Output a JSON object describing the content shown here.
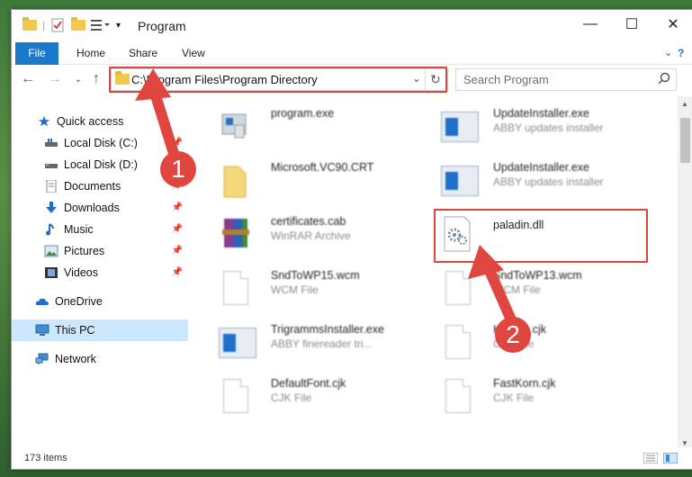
{
  "window": {
    "title": "Program"
  },
  "ribbon": {
    "tabs": [
      "File",
      "Home",
      "Share",
      "View"
    ]
  },
  "address": {
    "path": "C:\\Program Files\\Program Directory"
  },
  "search": {
    "placeholder": "Search Program"
  },
  "sidebar": {
    "items": [
      {
        "label": "Quick access",
        "icon": "star-icon",
        "pinned": false
      },
      {
        "label": "Local Disk (C:)",
        "icon": "drive-icon",
        "pinned": true
      },
      {
        "label": "Local Disk (D:)",
        "icon": "drive-icon",
        "pinned": false
      },
      {
        "label": "Documents",
        "icon": "documents-icon",
        "pinned": true
      },
      {
        "label": "Downloads",
        "icon": "download-icon",
        "pinned": true
      },
      {
        "label": "Music",
        "icon": "music-icon",
        "pinned": true
      },
      {
        "label": "Pictures",
        "icon": "pictures-icon",
        "pinned": true
      },
      {
        "label": "Videos",
        "icon": "videos-icon",
        "pinned": true
      },
      {
        "label": "OneDrive",
        "icon": "cloud-icon",
        "pinned": false
      },
      {
        "label": "This PC",
        "icon": "computer-icon",
        "pinned": false,
        "selected": true
      },
      {
        "label": "Network",
        "icon": "network-icon",
        "pinned": false
      }
    ]
  },
  "files": [
    {
      "name": "program.exe",
      "type": "",
      "icon": "exe-icon"
    },
    {
      "name": "UpdateInstaller.exe",
      "type": "ABBY updates installer",
      "icon": "installer-icon"
    },
    {
      "name": "Microsoft.VC90.CRT",
      "type": "",
      "icon": "folder-icon"
    },
    {
      "name": "UpdateInstaller.exe",
      "type": "ABBY updates installer",
      "icon": "installer-icon"
    },
    {
      "name": "certificates.cab",
      "type": "WinRAR Archive",
      "icon": "archive-icon"
    },
    {
      "name": "paladin.dll",
      "type": "",
      "icon": "dll-gear-icon"
    },
    {
      "name": "SndToWP15.wcm",
      "type": "WCM File",
      "icon": "file-icon"
    },
    {
      "name": "SndToWP13.wcm",
      "type": "WCM File",
      "icon": "file-icon"
    },
    {
      "name": "TrigrammsInstaller.exe",
      "type": "ABBY finereader tri...",
      "icon": "installer-icon"
    },
    {
      "name": "Korean.cjk",
      "type": "CJK File",
      "icon": "file-icon"
    },
    {
      "name": "DefaultFont.cjk",
      "type": "CJK File",
      "icon": "file-icon"
    },
    {
      "name": "FastKorn.cjk",
      "type": "CJK File",
      "icon": "file-icon"
    }
  ],
  "status": {
    "items_count": "173 items"
  },
  "annotations": {
    "step1": "1",
    "step2": "2"
  },
  "colors": {
    "accent": "#1979ca",
    "highlight": "#d9453f",
    "selection": "#cce8ff"
  }
}
